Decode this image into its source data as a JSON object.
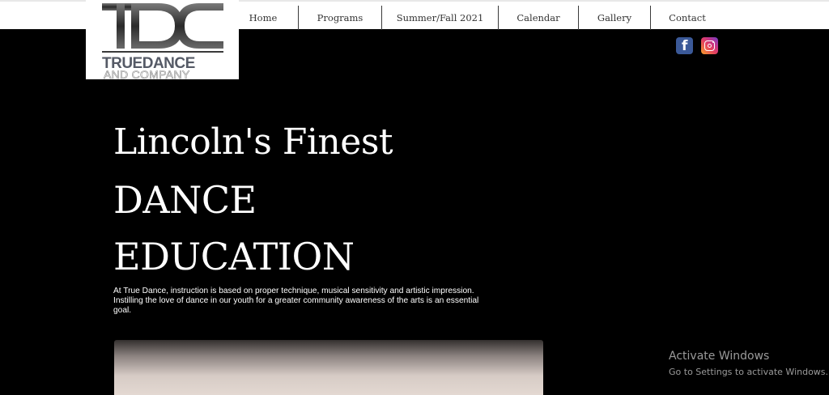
{
  "logo": {
    "monogram": "TDC",
    "line1": "TRUEDANCE",
    "line2": "AND COMPANY"
  },
  "nav": {
    "items": [
      {
        "label": "Home"
      },
      {
        "label": "Programs"
      },
      {
        "label": "Summer/Fall 2021"
      },
      {
        "label": "Calendar"
      },
      {
        "label": "Gallery"
      },
      {
        "label": "Contact"
      }
    ]
  },
  "social": {
    "icons": [
      "facebook-icon",
      "instagram-icon"
    ],
    "facebook_letter": "f"
  },
  "hero": {
    "line1": "Lincoln's Finest",
    "line2": "DANCE",
    "line3": "EDUCATION",
    "description": "At True Dance, instruction is based on proper technique, musical sensitivity and artistic impression. Instilling the love of dance in our youth for a greater community awareness of the arts is an essential goal."
  },
  "watermark": {
    "title": "Activate Windows",
    "subtitle": "Go to Settings to activate Windows."
  },
  "colors": {
    "background": "#000000",
    "nav_bg": "#ffffff",
    "nav_text": "#333333",
    "facebook": "#3b5998",
    "watermark_text": "#9a9a9a"
  }
}
